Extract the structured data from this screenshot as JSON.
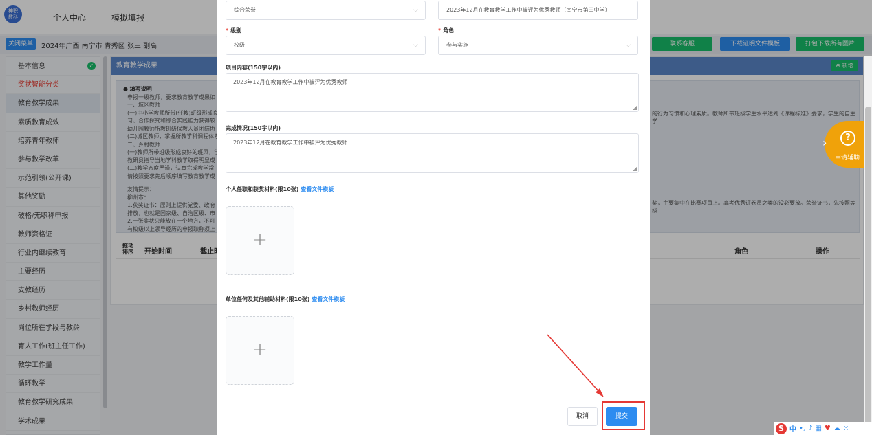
{
  "topbar": {
    "logo_line1": "神职",
    "logo_line2": "教科",
    "nav": [
      "个人中心",
      "模拟填报"
    ]
  },
  "breadcrumb": {
    "menu_toggle": "关闭菜单",
    "text": "2024年广西 南宁市 青秀区 张三 副高"
  },
  "toolbar": {
    "contact": "联系客服",
    "download_template": "下载证明文件模板",
    "download_images": "打包下载所有图片"
  },
  "sidebar": {
    "items": [
      "基本信息",
      "奖状智能分类",
      "教育教学成果",
      "素质教育成效",
      "培养青年教师",
      "参与教学改革",
      "示范引领(公开课)",
      "其他奖励",
      "破格/无职称申报",
      "教师资格证",
      "行业内继续教育",
      "主要经历",
      "支教经历",
      "乡村教师经历",
      "岗位所在学段与教龄",
      "育人工作(班主任工作)",
      "教学工作量",
      "循环教学",
      "教育教学研究成果",
      "学术成果"
    ]
  },
  "panel": {
    "title": "教育教学成果",
    "add_button": "新增",
    "notes_title": "填写说明",
    "notes": [
      "申报一级教师，要求教育教学成果如",
      "一、城区教师",
      "(一)中小学教师所带(任教)班级形成良",
      "习、合作探究和综合实践能力获得较",
      "幼儿园教师所教班级保教人员团结协",
      "(二)城区教师，掌握所教学科课程体系",
      "二、乡村教师",
      "(一)教师所带班级形成良好的班风，学",
      "教研员指导当地学科教学取得明显成",
      "(二)教学态度严谨，认真完成教学常",
      "请按照要求先后顺序填写教育教学成",
      "",
      "友情提示：",
      "柳州市：",
      "1.获奖证书：原则上提供党委、政府",
      "排放，也就是国家级、自治区级、市",
      "2.一张奖状只能放在一个地方，不可",
      "有校级以上领导经历的申报职称须上"
    ],
    "notes_right": [
      "的行为习惯和心理素质。教师所带班级学生水平达到《课程标准》要求，学生的自主学",
      "奖，主要集中在比赛项目上。高考优秀评卷员之类的没必要放。荣誉证书，先按照等级"
    ],
    "col_drag": "拖动排序",
    "col_start": "开始时间",
    "col_end": "截止时",
    "col_role": "角色",
    "col_action": "操作"
  },
  "help_float": {
    "label": "申请辅助",
    "icon": "help-icon"
  },
  "modal": {
    "category_value": "综合荣誉",
    "title_value": "2023年12月在教育教学工作中被评为优秀教师（南宁市第三中学）",
    "level_label": "级别",
    "level_value": "校级",
    "role_label": "角色",
    "role_value": "参与实施",
    "content_label": "项目内容(150字以内)",
    "content_value": "2023年12月在教育教学工作中被评为优秀教师",
    "completion_label": "完成情况(150字以内)",
    "completion_value": "2023年12月在教育教学工作中被评为优秀教师",
    "personal_label": "个人任职和获奖材料(限10张)",
    "personal_link": "查看文件模板",
    "unit_label": "单位任何及其他辅助材料(限10张)",
    "unit_link": "查看文件模板",
    "cancel": "取消",
    "submit": "提交"
  },
  "ime": {
    "items": [
      "中",
      "•,",
      "🎤",
      "⌨",
      "👕",
      "☁",
      "⋮⋮"
    ]
  },
  "colors": {
    "primary": "#2d8cf0",
    "green": "#19be6b",
    "panel_head": "#5b87c9",
    "highlight": "#e53935",
    "help": "#f0a20a"
  }
}
